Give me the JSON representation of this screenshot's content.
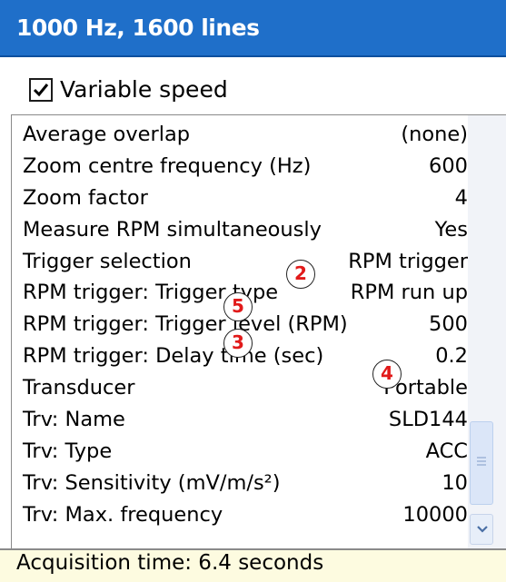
{
  "window": {
    "title": "1000 Hz, 1600 lines"
  },
  "checkbox": {
    "label": "Variable speed",
    "checked": true
  },
  "parameters": [
    {
      "label": "Average overlap",
      "value": "(none)"
    },
    {
      "label": "Zoom centre frequency (Hz)",
      "value": "600"
    },
    {
      "label": "Zoom factor",
      "value": "4"
    },
    {
      "label": "Measure RPM simultaneously",
      "value": "Yes"
    },
    {
      "label": "Trigger selection",
      "value": "RPM trigger"
    },
    {
      "label": "RPM trigger: Trigger type",
      "value": "RPM run up"
    },
    {
      "label": "RPM trigger: Trigger level (RPM)",
      "value": "500"
    },
    {
      "label": "RPM trigger: Delay time (sec)",
      "value": "0.2"
    },
    {
      "label": "Transducer",
      "value": "Portable"
    },
    {
      "label": "Trv: Name",
      "value": "SLD144"
    },
    {
      "label": "Trv: Type",
      "value": "ACC"
    },
    {
      "label": "Trv: Sensitivity (mV/m/s²)",
      "value": "10"
    },
    {
      "label": "Trv: Max. frequency",
      "value": "10000"
    }
  ],
  "markers": [
    "2",
    "5",
    "3",
    "4"
  ],
  "status": {
    "text": "Acquisition time: 6.4 seconds"
  },
  "scrollbar": {
    "thumb_icon": "grip-icon",
    "down_icon": "chevron-down-icon"
  },
  "colors": {
    "title_bar": "#1f6fc9",
    "status_bar": "#fdfbe0",
    "marker_text": "#e11a1a"
  }
}
